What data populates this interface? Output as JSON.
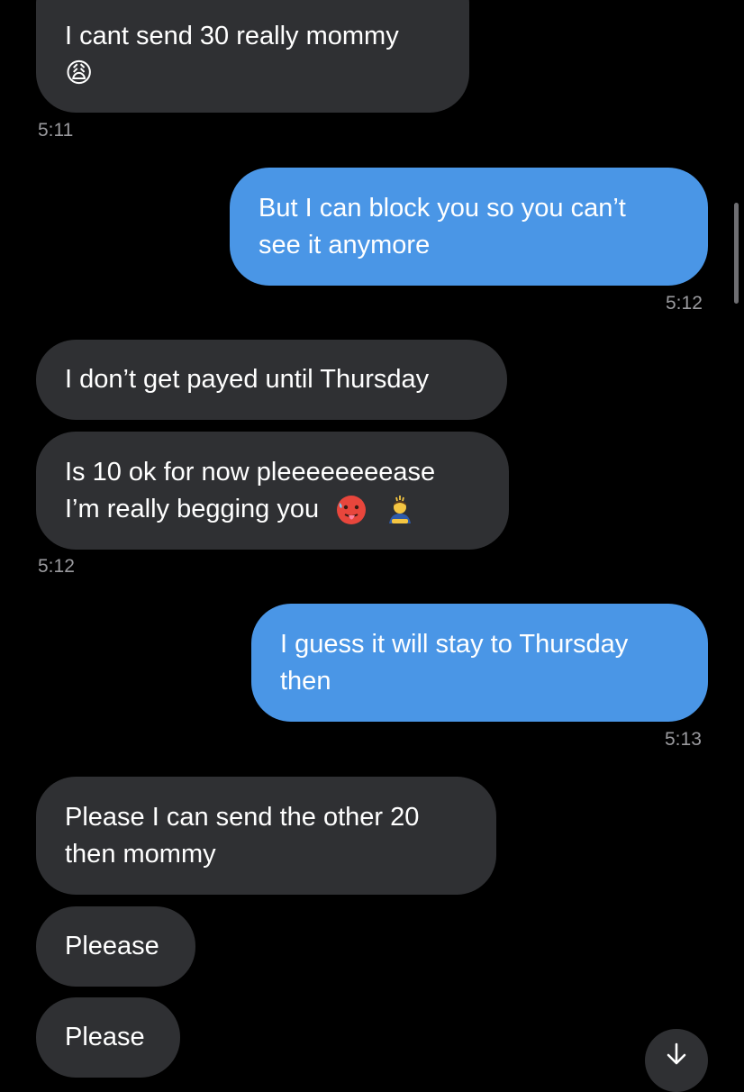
{
  "messages": [
    {
      "direction": "incoming",
      "lines": [
        "I cant send 30 really mommy"
      ],
      "emoji_line": "😩",
      "timestamp": "5:11"
    },
    {
      "direction": "outgoing",
      "lines": [
        "But I can block you so you can’t",
        "see it anymore"
      ],
      "timestamp": "5:12"
    },
    {
      "direction": "incoming",
      "lines": [
        "I don’t get payed until Thursday"
      ]
    },
    {
      "direction": "incoming",
      "lines": [
        "Is 10 ok for now pleeeeeeeease",
        "I’m really begging you"
      ],
      "emojis": [
        "hot-face-emoji",
        "bowing-person-emoji"
      ],
      "timestamp": "5:12"
    },
    {
      "direction": "outgoing",
      "lines": [
        "I guess it will stay to Thursday",
        "then"
      ],
      "timestamp": "5:13"
    },
    {
      "direction": "incoming",
      "lines": [
        "Please I can send the other 20",
        "then mommy"
      ]
    },
    {
      "direction": "incoming",
      "lines": [
        "Pleease"
      ]
    },
    {
      "direction": "incoming",
      "lines": [
        "Please"
      ]
    }
  ],
  "scroll_button": {
    "icon": "arrow-down-icon"
  },
  "colors": {
    "background": "#000000",
    "incoming_bubble": "#2f3033",
    "outgoing_bubble": "#4a96e6",
    "timestamp_text": "#9a9a9e"
  }
}
